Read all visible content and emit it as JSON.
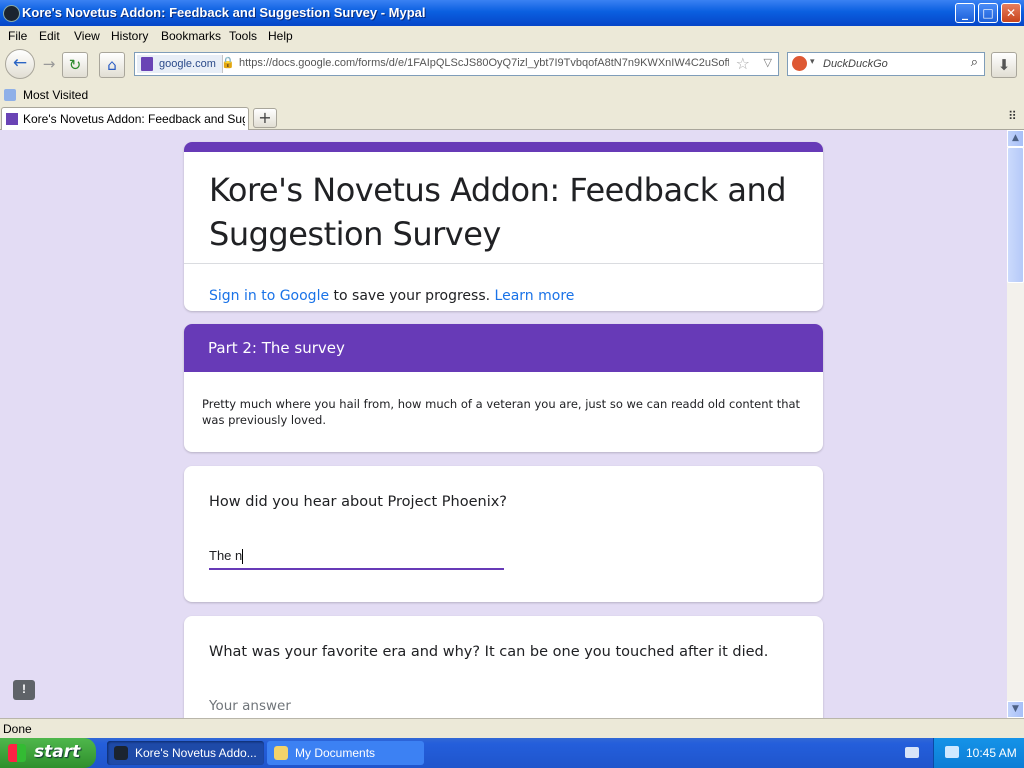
{
  "window": {
    "title": "Kore's Novetus Addon: Feedback and Suggestion Survey - Mypal",
    "controls": {
      "minimize": "_",
      "maximize": "□",
      "close": "✕"
    }
  },
  "menu": {
    "items": [
      "File",
      "Edit",
      "View",
      "History",
      "Bookmarks",
      "Tools",
      "Help"
    ]
  },
  "navbar": {
    "back_icon": "←",
    "forward_icon": "→",
    "reload_icon": "↻",
    "home_icon": "⌂",
    "site_label": "google.com",
    "lock_icon": "🔒",
    "url": "https://docs.google.com/forms/d/e/1FAIpQLScJS80OyQ7izl_ybt7I9TvbqofA8tN7n9KWXnIW4C2uSoff",
    "star_icon": "☆",
    "dropdown_icon": "▽",
    "search_placeholder": "DuckDuckGo",
    "search_icon": "⌕",
    "download_icon": "⬇"
  },
  "bookmarks": {
    "most_visited": "Most Visited"
  },
  "tabs": {
    "active_label": "Kore's Novetus Addon: Feedback and Sugge...",
    "new_tab": "+",
    "list_all": "⠿"
  },
  "form": {
    "title": "Kore's Novetus Addon: Feedback and Suggestion Survey",
    "sign_in_link": "Sign in to Google",
    "sign_in_text": " to save your progress. ",
    "learn_more": "Learn more",
    "section_title": "Part 2: The survey",
    "section_description": "Pretty much where you hail from, how much of a veteran you are, just so we can readd old content that was previously loved.",
    "questions": [
      {
        "title": "How did you hear about Project Phoenix?",
        "answer": "The n"
      },
      {
        "title": "What was your favorite era and why? It can be one you touched after it died.",
        "placeholder": "Your answer"
      }
    ],
    "feedback_icon": "!"
  },
  "statusbar": {
    "text": "Done"
  },
  "taskbar": {
    "start_label": "start",
    "tasks": [
      "Kore's Novetus Addo...",
      "My Documents"
    ],
    "clock": "10:45 AM"
  },
  "colors": {
    "accent": "#673ab7",
    "background": "#e3dcf4",
    "link": "#1a73e8"
  }
}
